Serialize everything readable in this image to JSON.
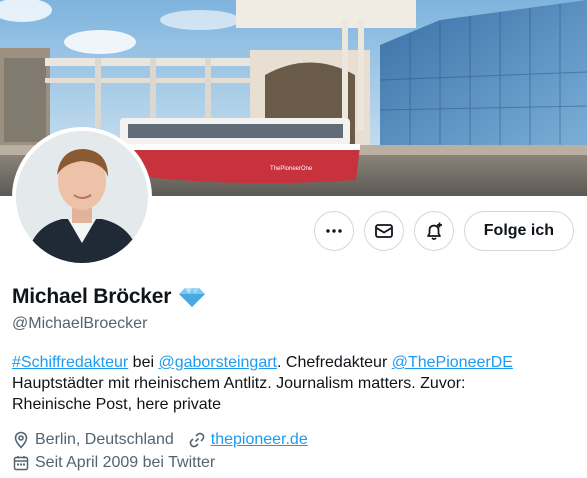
{
  "banner": {
    "boat_text": "ThePioneerOne"
  },
  "actions": {
    "more": {
      "icon": "more-icon"
    },
    "message": {
      "icon": "envelope-icon"
    },
    "notify": {
      "icon": "bell-plus-icon"
    },
    "follow_label": "Folge ich"
  },
  "profile": {
    "name": "Michael Bröcker",
    "badge_icon": "diamond-icon",
    "handle": "@MichaelBroecker"
  },
  "bio": {
    "hashtag": "#Schiffredakteur",
    "word_bei": " bei ",
    "mention1": "@gaborsteingart",
    "text1": ". Chefredakteur ",
    "mention2": "@ThePioneerDE",
    "line2": "Hauptstädter mit rheinischem Antlitz. Journalism matters. Zuvor:",
    "line3": "Rheinische Post, here private"
  },
  "meta": {
    "location": "Berlin, Deutschland",
    "website": "thepioneer.de",
    "joined": "Seit April 2009 bei Twitter"
  },
  "colors": {
    "accent": "#1d9bf0",
    "text": "#0f1419",
    "muted": "#536471",
    "border": "#cfd9de"
  }
}
